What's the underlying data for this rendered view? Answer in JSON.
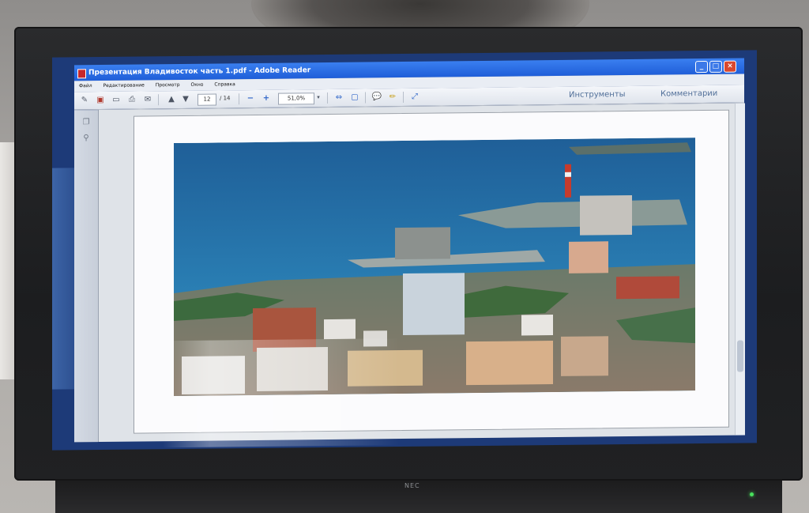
{
  "window": {
    "title": "Презентация Владивосток часть 1.pdf - Adobe Reader",
    "controls": {
      "minimize": "_",
      "maximize": "□",
      "close": "×"
    }
  },
  "menu": {
    "items": [
      "Файл",
      "Редактирование",
      "Просмотр",
      "Окно",
      "Справка"
    ]
  },
  "toolbar": {
    "page_current": "12",
    "page_total": "/ 14",
    "zoom": "51,0%",
    "tools_label": "Инструменты",
    "comments_label": "Комментарии"
  },
  "monitor": {
    "brand": "NEC"
  },
  "document": {
    "photo_subject": "Vladivostok aerial view"
  },
  "colors": {
    "titlebar": "#1f5ed8",
    "toolbar_bg": "#e5e9f0",
    "page_bg": "#fbfbfd"
  }
}
